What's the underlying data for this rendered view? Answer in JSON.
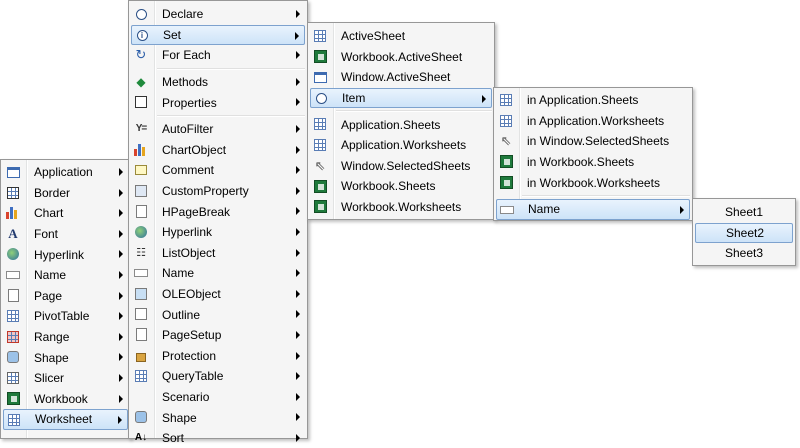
{
  "colors": {
    "menu_bg": "#f5f5f5",
    "menu_border": "#979797",
    "highlight_top": "#e9f3fd",
    "highlight_bottom": "#cde3f8",
    "highlight_border": "#7da2ce"
  },
  "menu_objects": {
    "items": [
      {
        "label": "Application",
        "icon": "application-icon"
      },
      {
        "label": "Border",
        "icon": "border-icon"
      },
      {
        "label": "Chart",
        "icon": "chart-icon"
      },
      {
        "label": "Font",
        "icon": "font-icon"
      },
      {
        "label": "Hyperlink",
        "icon": "hyperlink-icon"
      },
      {
        "label": "Name",
        "icon": "name-icon"
      },
      {
        "label": "Page",
        "icon": "page-icon"
      },
      {
        "label": "PivotTable",
        "icon": "pivottable-icon"
      },
      {
        "label": "Range",
        "icon": "range-icon"
      },
      {
        "label": "Shape",
        "icon": "shape-icon"
      },
      {
        "label": "Slicer",
        "icon": "slicer-icon"
      },
      {
        "label": "Workbook",
        "icon": "workbook-icon"
      },
      {
        "label": "Worksheet",
        "icon": "worksheet-icon",
        "selected": true
      }
    ]
  },
  "menu_members": {
    "items": [
      {
        "label": "Declare",
        "icon": "declare-icon"
      },
      {
        "label": "Set",
        "icon": "set-icon",
        "selected": true
      },
      {
        "label": "For Each",
        "icon": "for-each-icon"
      },
      {
        "label": "Methods",
        "icon": "methods-icon"
      },
      {
        "label": "Properties",
        "icon": "properties-icon"
      },
      {
        "label": "AutoFilter",
        "icon": "autofilter-icon"
      },
      {
        "label": "ChartObject",
        "icon": "chartobject-icon"
      },
      {
        "label": "Comment",
        "icon": "comment-icon"
      },
      {
        "label": "CustomProperty",
        "icon": "customproperty-icon"
      },
      {
        "label": "HPageBreak",
        "icon": "hpagebreak-icon"
      },
      {
        "label": "Hyperlink",
        "icon": "hyperlink-icon"
      },
      {
        "label": "ListObject",
        "icon": "listobject-icon"
      },
      {
        "label": "Name",
        "icon": "name-icon"
      },
      {
        "label": "OLEObject",
        "icon": "oleobject-icon"
      },
      {
        "label": "Outline",
        "icon": "outline-icon"
      },
      {
        "label": "PageSetup",
        "icon": "pagesetup-icon"
      },
      {
        "label": "Protection",
        "icon": "protection-icon"
      },
      {
        "label": "QueryTable",
        "icon": "querytable-icon"
      },
      {
        "label": "Scenario",
        "icon": "scenario-icon"
      },
      {
        "label": "Shape",
        "icon": "shape-icon"
      },
      {
        "label": "Sort",
        "icon": "sort-icon"
      }
    ]
  },
  "menu_set": {
    "items": [
      {
        "label": "ActiveSheet",
        "icon": "sheet-icon"
      },
      {
        "label": "Workbook.ActiveSheet",
        "icon": "workbook-icon"
      },
      {
        "label": "Window.ActiveSheet",
        "icon": "window-icon"
      },
      {
        "label": "Item",
        "icon": "circle-icon",
        "selected": true
      },
      {
        "label": "Application.Sheets",
        "icon": "sheet-icon"
      },
      {
        "label": "Application.Worksheets",
        "icon": "sheet-icon"
      },
      {
        "label": "Window.SelectedSheets",
        "icon": "cursor-icon"
      },
      {
        "label": "Workbook.Sheets",
        "icon": "workbook-icon"
      },
      {
        "label": "Workbook.Worksheets",
        "icon": "workbook-icon"
      }
    ]
  },
  "menu_item": {
    "items": [
      {
        "label": "in Application.Sheets",
        "icon": "sheet-icon"
      },
      {
        "label": "in Application.Worksheets",
        "icon": "sheet-icon"
      },
      {
        "label": "in Window.SelectedSheets",
        "icon": "cursor-icon"
      },
      {
        "label": "in Workbook.Sheets",
        "icon": "workbook-icon"
      },
      {
        "label": "in Workbook.Worksheets",
        "icon": "workbook-icon"
      },
      {
        "label": "Name",
        "icon": "name-icon",
        "selected": true
      }
    ]
  },
  "menu_sheets": {
    "items": [
      {
        "label": "Sheet1"
      },
      {
        "label": "Sheet2",
        "selected": true
      },
      {
        "label": "Sheet3"
      }
    ]
  }
}
